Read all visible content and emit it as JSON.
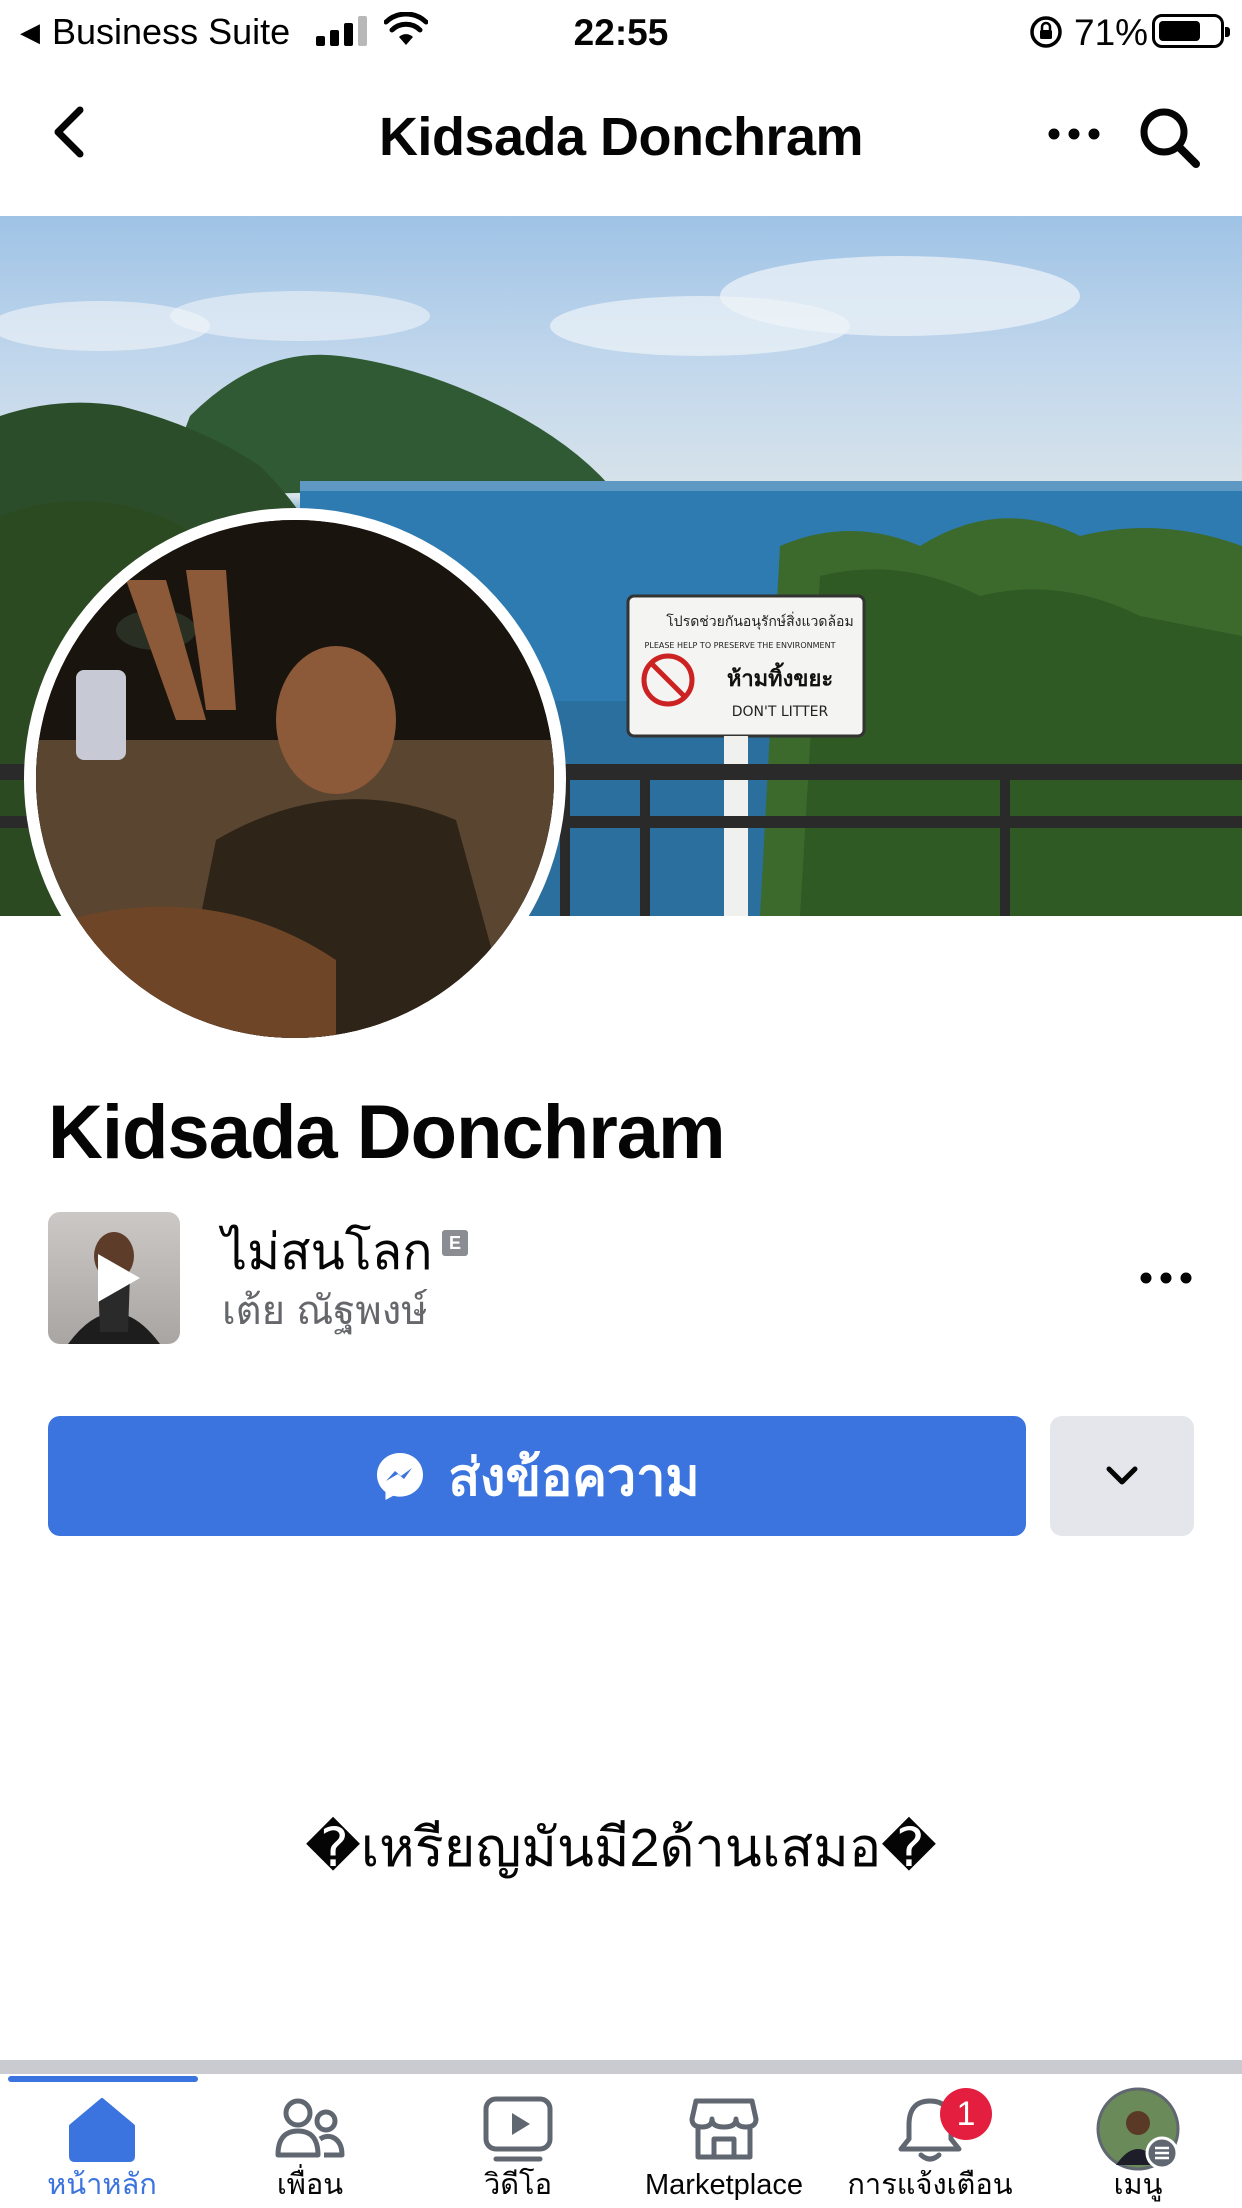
{
  "status_bar": {
    "back_app": "Business Suite",
    "time": "22:55",
    "battery_percent": "71%",
    "battery_level": 0.71
  },
  "header": {
    "title": "Kidsada Donchram",
    "back_icon": "chevron-left-icon",
    "more_icon": "more-horizontal-icon",
    "search_icon": "search-icon"
  },
  "profile": {
    "name": "Kidsada Donchram",
    "cover_sign_lines": [
      "โปรดช่วยกันอนุรักษ์สิ่งแวดล้อม",
      "PLEASE HELP TO PRESERVE THE ENVIRONMENT",
      "ห้ามทิ้งขยะ",
      "DON'T LITTER"
    ],
    "bio": "�เหรียญมันมี2ด้านเสมอ�"
  },
  "music": {
    "title": "ไม่สนโลก",
    "explicit_badge": "E",
    "artist": "เต้ย ณัฐพงษ์"
  },
  "actions": {
    "message_label": "ส่งข้อความ",
    "message_icon": "messenger-icon",
    "dropdown_icon": "chevron-down-icon"
  },
  "tab_bar": {
    "tabs": [
      {
        "label": "หน้าหลัก",
        "icon": "home-icon",
        "active": true
      },
      {
        "label": "เพื่อน",
        "icon": "friends-icon",
        "active": false
      },
      {
        "label": "วิดีโอ",
        "icon": "video-icon",
        "active": false
      },
      {
        "label": "Marketplace",
        "icon": "marketplace-icon",
        "active": false
      },
      {
        "label": "การแจ้งเตือน",
        "icon": "bell-icon",
        "active": false,
        "badge": "1"
      },
      {
        "label": "เมนู",
        "icon": "menu-avatar-icon",
        "active": false
      }
    ]
  },
  "colors": {
    "accent": "#3b74de",
    "badge_red": "#e41e3f",
    "secondary_text": "#65676b",
    "button_gray": "#e4e6eb"
  }
}
